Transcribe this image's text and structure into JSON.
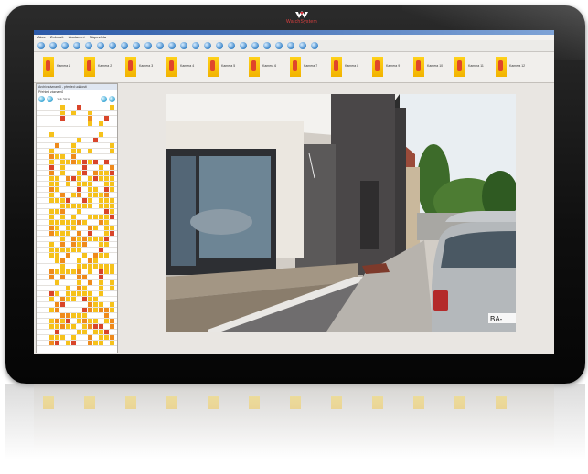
{
  "brand": {
    "name": "WatchSystem"
  },
  "menu": [
    "Akce",
    "Zobrazit",
    "Nastavení",
    "Nápověda"
  ],
  "filmstrip": {
    "cameras": [
      "Kamera 1",
      "Kamera 2",
      "Kamera 3",
      "Kamera 4",
      "Kamera 5",
      "Kamera 6",
      "Kamera 7",
      "Kamera 8",
      "Kamera 9",
      "Kamera 10",
      "Kamera 11",
      "Kamera 12"
    ]
  },
  "side": {
    "header": "Archiv záznamů - přehled událostí",
    "subtitle": "Přehled záznamů",
    "date": "1.8.2011"
  },
  "colors": {
    "frame": "#111111",
    "accent": "#3c86c9",
    "event_low": "#f6c21b",
    "event_mid": "#ef8b1c",
    "event_high": "#d9452a"
  }
}
